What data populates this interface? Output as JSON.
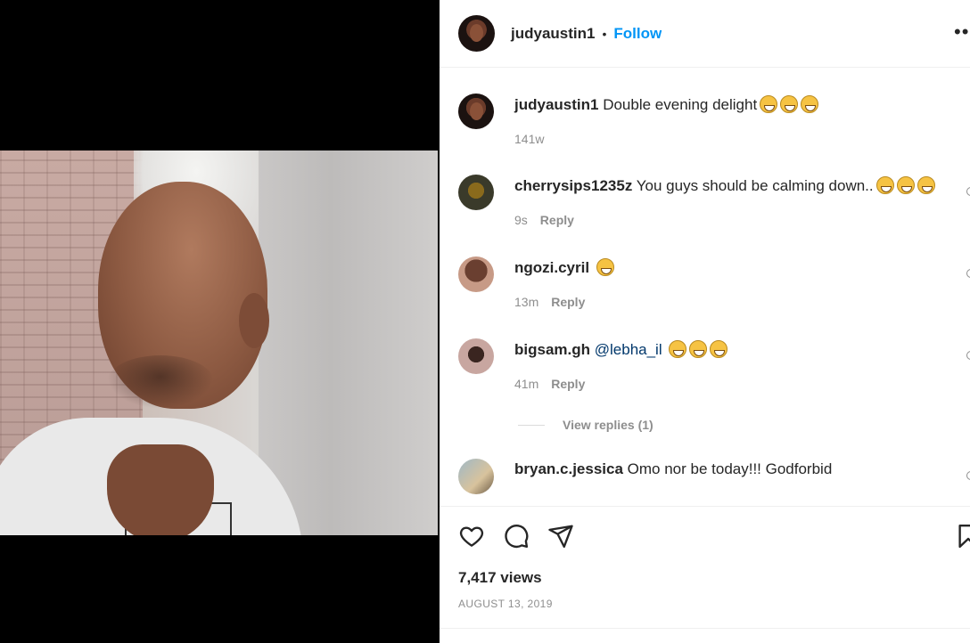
{
  "post": {
    "username": "judyaustin1",
    "separator": "•",
    "follow_label": "Follow",
    "more_label": "••",
    "caption": {
      "username": "judyaustin1",
      "text": "Double evening delight",
      "emoji_count": 3,
      "time": "141w"
    }
  },
  "comments": [
    {
      "username": "cherrysips1235z",
      "text": "You guys should be calming down..",
      "emoji_count": 3,
      "time": "9s",
      "reply_label": "Reply"
    },
    {
      "username": "ngozi.cyril",
      "text": "",
      "emoji_count": 1,
      "time": "13m",
      "reply_label": "Reply"
    },
    {
      "username": "bigsam.gh",
      "mention": "@lebha_il",
      "text": "",
      "emoji_count": 3,
      "time": "41m",
      "reply_label": "Reply"
    },
    {
      "username": "bryan.c.jessica",
      "text": "Omo nor be today!!! Godforbid",
      "emoji_count": 0,
      "time": "",
      "reply_label": ""
    }
  ],
  "view_replies_label": "View replies (1)",
  "actions": {
    "like_icon": "heart-icon",
    "comment_icon": "comment-icon",
    "share_icon": "share-icon",
    "save_icon": "bookmark-icon"
  },
  "views_label": "7,417 views",
  "date_label": "AUGUST 13, 2019",
  "video": {
    "mute_icon": "speaker-muted-icon"
  },
  "colors": {
    "link_blue": "#0095f6",
    "mention_blue": "#00376b",
    "meta_gray": "#8e8e8e",
    "text": "#262626"
  }
}
